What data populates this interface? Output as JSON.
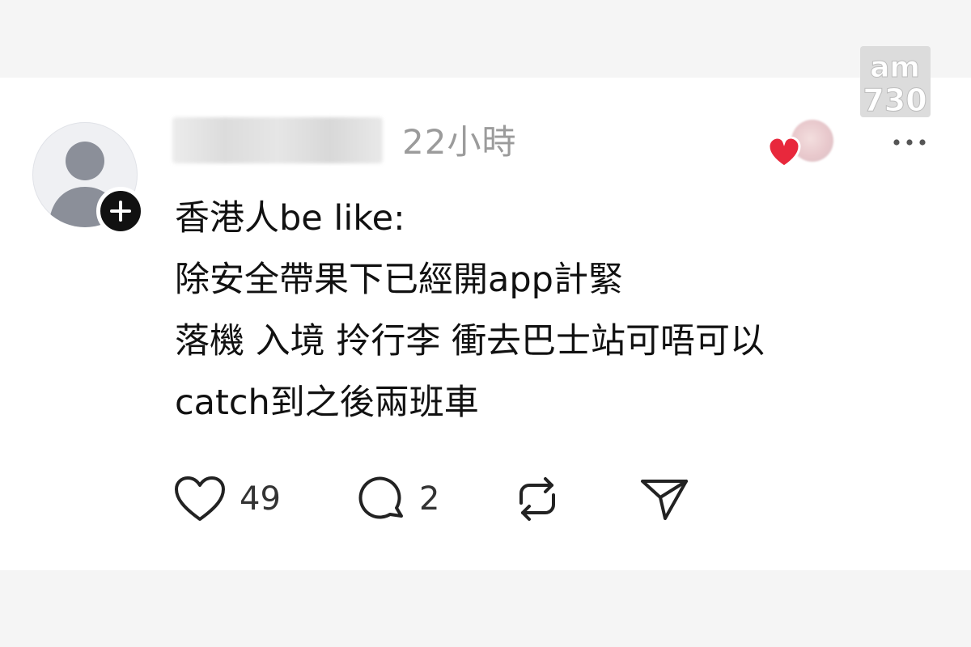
{
  "watermark": {
    "brand_icon": "am730-logo"
  },
  "post": {
    "author": {
      "avatar_icon": "default-user-avatar",
      "follow_icon": "plus-icon"
    },
    "timestamp": "22小時",
    "liked_by_icon": "heart-icon",
    "more_icon": "more-horizontal-icon",
    "text": "香港人be like:\n除安全帶果下已經開app計緊\n落機 入境 拎行李 衝去巴士站可唔可以\ncatch到之後兩班車"
  },
  "actions": {
    "like": {
      "icon": "heart-outline-icon",
      "count": "49"
    },
    "reply": {
      "icon": "comment-icon",
      "count": "2"
    },
    "repost": {
      "icon": "repost-icon"
    },
    "share": {
      "icon": "send-icon"
    }
  },
  "colors": {
    "accent_red": "#e8283c",
    "text": "#111111",
    "muted": "#9b9b9b"
  }
}
